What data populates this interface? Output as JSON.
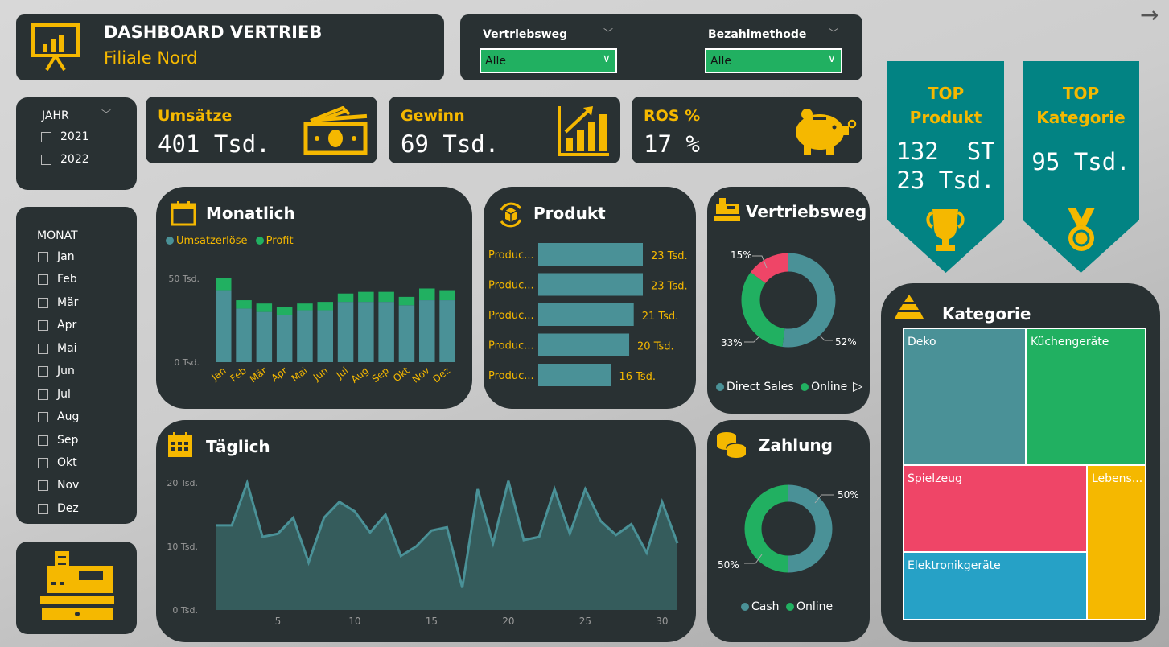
{
  "header": {
    "title": "DASHBOARD VERTRIEB",
    "subtitle": "Filiale Nord"
  },
  "filters": {
    "vertriebsweg": {
      "label": "Vertriebsweg",
      "value": "Alle"
    },
    "bezahlmethode": {
      "label": "Bezahlmethode",
      "value": "Alle"
    }
  },
  "kpis": {
    "umsatz": {
      "label": "Umsätze",
      "value": "401 Tsd."
    },
    "gewinn": {
      "label": "Gewinn",
      "value": "69 Tsd."
    },
    "ros": {
      "label": "ROS %",
      "value": "17 %"
    }
  },
  "year_slicer": {
    "title": "JAHR",
    "options": [
      "2021",
      "2022"
    ]
  },
  "month_slicer": {
    "title": "MONAT",
    "options": [
      "Jan",
      "Feb",
      "Mär",
      "Apr",
      "Mai",
      "Jun",
      "Jul",
      "Aug",
      "Sep",
      "Okt",
      "Nov",
      "Dez"
    ]
  },
  "monatlich": {
    "title": "Monatlich",
    "legend": [
      "Umsatzerlöse",
      "Profit"
    ]
  },
  "produkt": {
    "title": "Produkt"
  },
  "vertriebsweg": {
    "title": "Vertriebsweg",
    "legend": [
      "Direct Sales",
      "Online"
    ]
  },
  "taeglich": {
    "title": "Täglich"
  },
  "zahlung": {
    "title": "Zahlung",
    "legend": [
      "Cash",
      "Online"
    ]
  },
  "top_produkt": {
    "line1": "TOP",
    "line2": "Produkt",
    "value1": "132  ST",
    "value2": "23 Tsd."
  },
  "top_kategorie": {
    "line1": "TOP",
    "line2": "Kategorie",
    "value": "95 Tsd."
  },
  "kategorie": {
    "title": "Kategorie",
    "tiles": [
      "Deko",
      "Küchengeräte",
      "Spielzeug",
      "Lebens...",
      "Elektronikgeräte"
    ]
  },
  "colors": {
    "panel": "#293133",
    "accent": "#f5b800",
    "teal": "#4a9197",
    "green": "#21b061",
    "pink": "#ef4567",
    "blue": "#26a1c6",
    "banner": "#028383"
  },
  "chart_data": [
    {
      "type": "bar",
      "title": "Monatlich",
      "stacked": true,
      "categories": [
        "Jan",
        "Feb",
        "Mär",
        "Apr",
        "Mai",
        "Jun",
        "Jul",
        "Aug",
        "Sep",
        "Okt",
        "Nov",
        "Dez"
      ],
      "series": [
        {
          "name": "Umsatzerlöse",
          "values": [
            43,
            32,
            30,
            28,
            31,
            31,
            36,
            36,
            36,
            34,
            37,
            37
          ]
        },
        {
          "name": "Profit",
          "values": [
            7,
            5,
            5,
            5,
            4,
            5,
            5,
            6,
            6,
            5,
            7,
            6
          ]
        }
      ],
      "yticks": [
        "50 Tsd.",
        "0 Tsd."
      ],
      "ylim": [
        0,
        50
      ]
    },
    {
      "type": "bar",
      "title": "Produkt",
      "orientation": "horizontal",
      "categories": [
        "Produc...",
        "Produc...",
        "Produc...",
        "Produc...",
        "Produc..."
      ],
      "values": [
        23,
        23,
        21,
        20,
        16
      ],
      "labels": [
        "23 Tsd.",
        "23 Tsd.",
        "21 Tsd.",
        "20 Tsd.",
        "16 Tsd."
      ]
    },
    {
      "type": "pie",
      "title": "Vertriebsweg",
      "donut": true,
      "slices": [
        {
          "value": 52,
          "label": "52%",
          "color": "#4a9197"
        },
        {
          "value": 33,
          "label": "33%",
          "color": "#21b061"
        },
        {
          "value": 15,
          "label": "15%",
          "color": "#ef4567"
        }
      ]
    },
    {
      "type": "area",
      "title": "Täglich",
      "x": [
        1,
        2,
        3,
        4,
        5,
        6,
        7,
        8,
        9,
        10,
        11,
        12,
        13,
        14,
        15,
        16,
        17,
        18,
        19,
        20,
        21,
        22,
        23,
        24,
        25,
        26,
        27,
        28,
        29,
        30,
        31
      ],
      "values": [
        13.3,
        13.3,
        20,
        11.5,
        12,
        14.5,
        7.5,
        14.5,
        17,
        15.5,
        12.2,
        15,
        8.5,
        10,
        12.5,
        13,
        3.5,
        19,
        10.5,
        20.3,
        11,
        11.5,
        19,
        12,
        19,
        14,
        11.8,
        13.5,
        9,
        17,
        10.5
      ],
      "xticks": [
        5,
        10,
        15,
        20,
        25,
        30
      ],
      "yticks": [
        "20 Tsd.",
        "10 Tsd.",
        "0 Tsd."
      ],
      "ylim": [
        0,
        20
      ]
    },
    {
      "type": "pie",
      "title": "Zahlung",
      "donut": true,
      "slices": [
        {
          "value": 50,
          "label": "50%",
          "color": "#4a9197"
        },
        {
          "value": 50,
          "label": "50%",
          "color": "#21b061"
        }
      ]
    },
    {
      "type": "heatmap",
      "title": "Kategorie",
      "subtype": "treemap",
      "tiles": [
        {
          "name": "Deko",
          "color": "#4a9197"
        },
        {
          "name": "Küchengeräte",
          "color": "#21b061"
        },
        {
          "name": "Spielzeug",
          "color": "#ef4567"
        },
        {
          "name": "Lebens...",
          "color": "#f5b800"
        },
        {
          "name": "Elektronikgeräte",
          "color": "#26a1c6"
        }
      ]
    }
  ]
}
